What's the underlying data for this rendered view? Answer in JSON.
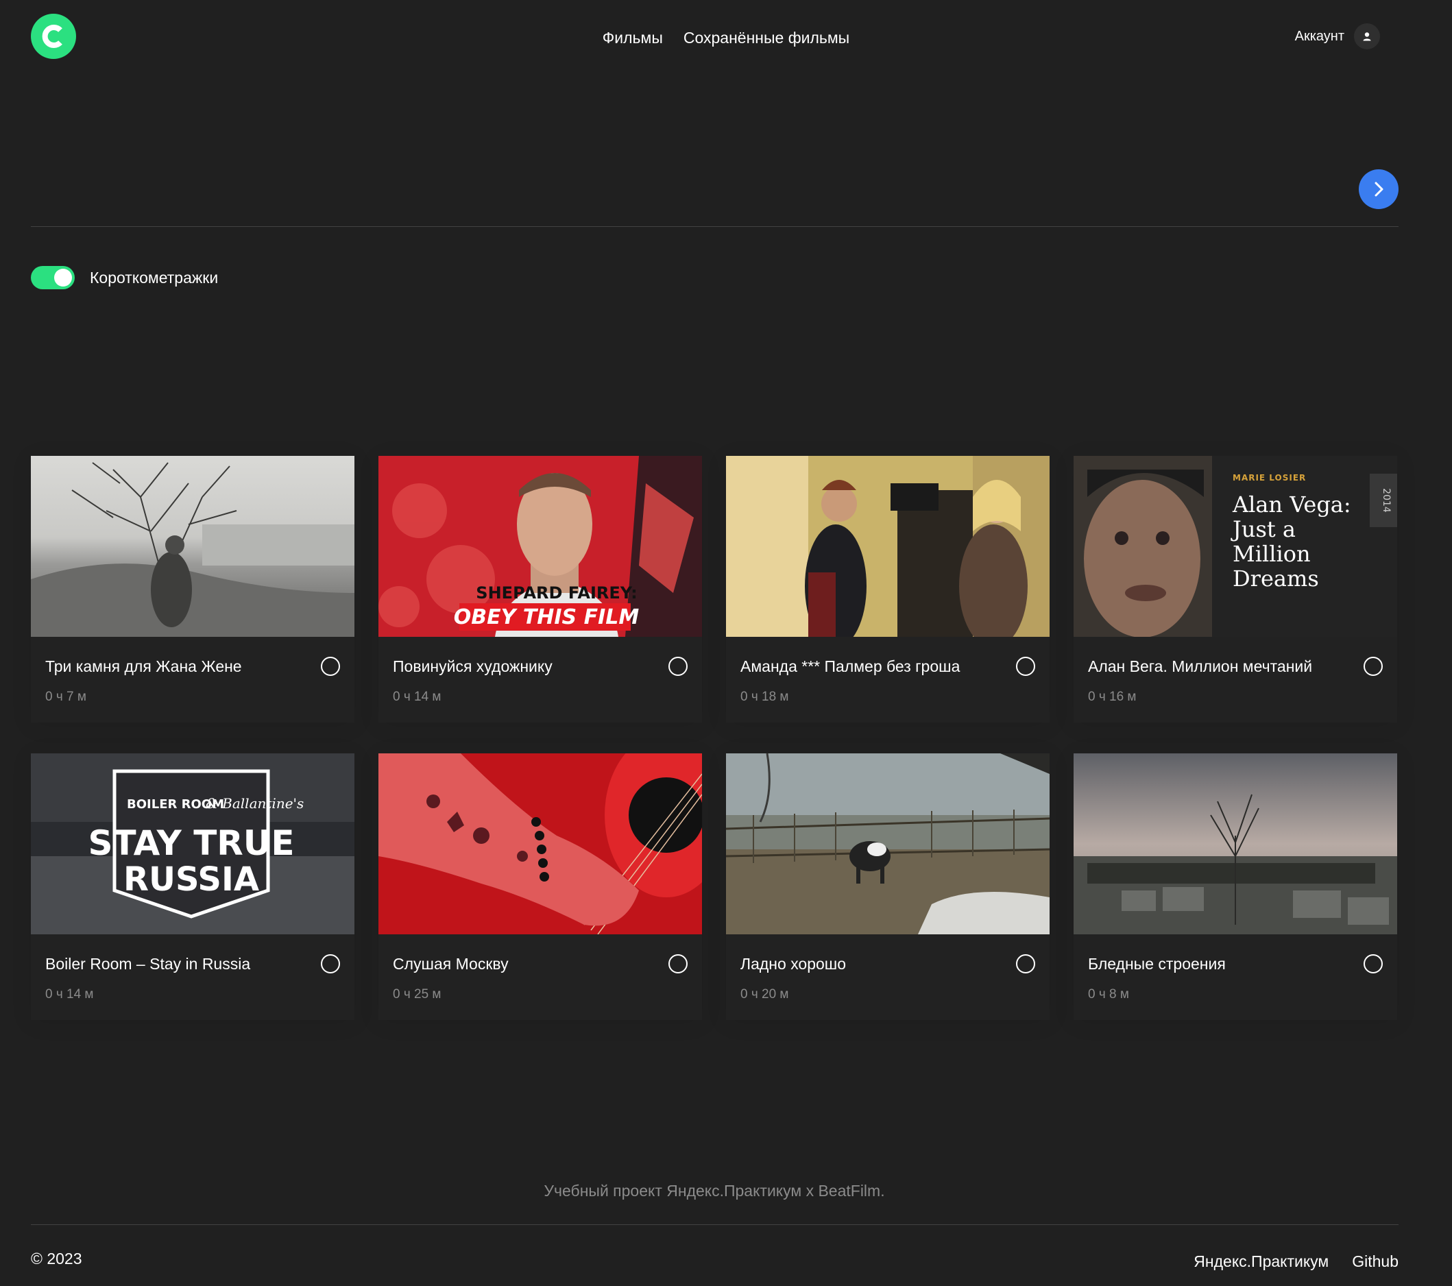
{
  "header": {
    "nav": {
      "movies": "Фильмы",
      "saved_movies": "Сохранённые фильмы"
    },
    "account_label": "Аккаунт"
  },
  "filter": {
    "short_films_label": "Короткометражки",
    "short_films_enabled": true
  },
  "movies": [
    {
      "title": "Три камня для Жана Жене",
      "duration": "0 ч 7 м",
      "saved": false
    },
    {
      "title": "Повинуйся художнику",
      "duration": "0 ч 14 м",
      "saved": false,
      "poster_text": {
        "line1": "SHEPARD FAIREY:",
        "line2": "OBEY THIS FILM"
      }
    },
    {
      "title": "Аманда *** Палмер без гроша",
      "duration": "0 ч 18 м",
      "saved": false
    },
    {
      "title": "Алан Вега. Миллион мечтаний",
      "duration": "0 ч 16 м",
      "saved": false,
      "poster_text": {
        "director": "MARIE LOSIER",
        "title_lines": [
          "Alan Vega:",
          "Just a",
          "Million",
          "Dreams"
        ],
        "year": "2014"
      }
    },
    {
      "title": "Boiler Room – Stay in Russia",
      "duration": "0 ч 14 м",
      "saved": false,
      "poster_text": {
        "brand": "BOILER ROOM",
        "partner": "& Ballantine's",
        "line1": "STAY TRUE",
        "line2": "RUSSIA"
      }
    },
    {
      "title": "Слушая Москву",
      "duration": "0 ч 25 м",
      "saved": false
    },
    {
      "title": "Ладно хорошо",
      "duration": "0 ч 20 м",
      "saved": false
    },
    {
      "title": "Бледные строения",
      "duration": "0 ч 8 м",
      "saved": false
    }
  ],
  "footer": {
    "note": "Учебный проект Яндекс.Практикум х BeatFilm.",
    "copyright": "© 2023",
    "links": {
      "practicum": "Яндекс.Практикум",
      "github": "Github"
    }
  },
  "colors": {
    "background": "#202020",
    "accent_green": "#2be080",
    "accent_blue": "#3a7df0",
    "muted_text": "#8b8b8b"
  }
}
